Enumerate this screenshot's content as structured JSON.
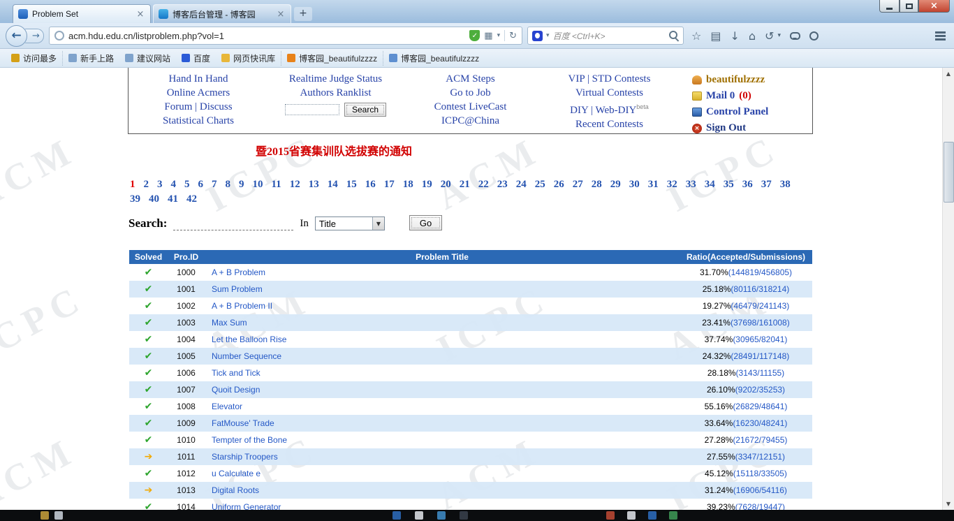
{
  "icons": {
    "close": "×",
    "new_tab": "+",
    "back": "←",
    "forward": "→",
    "reload": "↻",
    "caret": "▾",
    "select_caret": "▼",
    "check": "✓",
    "grid": "▦",
    "star": "☆",
    "list": "▤",
    "download": "↓",
    "home": "⌂",
    "history": "↺",
    "scroll_up": "▲",
    "scroll_down": "▼"
  },
  "browser": {
    "tabs": [
      {
        "title": "Problem Set"
      },
      {
        "title": "博客后台管理 - 博客园"
      }
    ],
    "url": "acm.hdu.edu.cn/listproblem.php?vol=1",
    "search_placeholder": "百度 <Ctrl+K>",
    "bookmarks": [
      "访问最多",
      "新手上路",
      "建议网站",
      "百度",
      "网页快讯库",
      "博客园_beautifulzzzz",
      "博客园_beautifulzzzz"
    ]
  },
  "site_nav": {
    "col1": [
      "Hand In Hand",
      "Online Acmers",
      "Forum | Discuss",
      "Statistical Charts"
    ],
    "col2": [
      "Realtime Judge Status",
      "Authors Ranklist"
    ],
    "search_input_value": "",
    "search_button": "Search",
    "col3": [
      "ACM Steps",
      "Go to Job",
      "Contest LiveCast",
      "ICPC@China"
    ],
    "col4": [
      "VIP | STD Contests",
      "Virtual Contests",
      "DIY | Web-DIY",
      "Recent Contests"
    ],
    "beta": "beta",
    "user": {
      "name": "beautifulzzzz",
      "mail": "Mail 0",
      "mail_badge": "(0)",
      "control_panel": "Control Panel",
      "sign_out": "Sign Out"
    }
  },
  "notice": "暨2015省赛集训队选拔赛的通知",
  "pagination": {
    "current": "1",
    "row1": [
      "1",
      "2",
      "3",
      "4",
      "5",
      "6",
      "7",
      "8",
      "9",
      "10",
      "11",
      "12",
      "13",
      "14",
      "15",
      "16",
      "17",
      "18",
      "19",
      "20",
      "21",
      "22",
      "23",
      "24",
      "25",
      "26",
      "27",
      "28",
      "29",
      "30",
      "31",
      "32",
      "33",
      "34",
      "35",
      "36",
      "37",
      "38"
    ],
    "row2": [
      "39",
      "40",
      "41",
      "42"
    ]
  },
  "search": {
    "label": "Search:",
    "input_value": "",
    "in_label": "In",
    "select_value": "Title",
    "go_button": "Go"
  },
  "problem_table": {
    "headers": [
      "Solved",
      "Pro.ID",
      "Problem Title",
      "Ratio(Accepted/Submissions)"
    ],
    "rows": [
      {
        "status": "solved",
        "icon": "✔",
        "id": "1000",
        "title": "A + B Problem",
        "percent": "31.70%",
        "ratio": "(144819/456805)"
      },
      {
        "status": "solved",
        "icon": "✔",
        "id": "1001",
        "title": "Sum Problem",
        "percent": "25.18%",
        "ratio": "(80116/318214)"
      },
      {
        "status": "solved",
        "icon": "✔",
        "id": "1002",
        "title": "A + B Problem II",
        "percent": "19.27%",
        "ratio": "(46479/241143)"
      },
      {
        "status": "solved",
        "icon": "✔",
        "id": "1003",
        "title": "Max Sum",
        "percent": "23.41%",
        "ratio": "(37698/161008)"
      },
      {
        "status": "solved",
        "icon": "✔",
        "id": "1004",
        "title": "Let the Balloon Rise",
        "percent": "37.74%",
        "ratio": "(30965/82041)"
      },
      {
        "status": "solved",
        "icon": "✔",
        "id": "1005",
        "title": "Number Sequence",
        "percent": "24.32%",
        "ratio": "(28491/117148)"
      },
      {
        "status": "solved",
        "icon": "✔",
        "id": "1006",
        "title": "Tick and Tick",
        "percent": "28.18%",
        "ratio": "(3143/11155)"
      },
      {
        "status": "solved",
        "icon": "✔",
        "id": "1007",
        "title": "Quoit Design",
        "percent": "26.10%",
        "ratio": "(9202/35253)"
      },
      {
        "status": "solved",
        "icon": "✔",
        "id": "1008",
        "title": "Elevator",
        "percent": "55.16%",
        "ratio": "(26829/48641)"
      },
      {
        "status": "solved",
        "icon": "✔",
        "id": "1009",
        "title": "FatMouse' Trade",
        "percent": "33.64%",
        "ratio": "(16230/48241)"
      },
      {
        "status": "solved",
        "icon": "✔",
        "id": "1010",
        "title": "Tempter of the Bone",
        "percent": "27.28%",
        "ratio": "(21672/79455)"
      },
      {
        "status": "tried",
        "icon": "➔",
        "id": "1011",
        "title": "Starship Troopers",
        "percent": "27.55%",
        "ratio": "(3347/12151)"
      },
      {
        "status": "solved",
        "icon": "✔",
        "id": "1012",
        "title": "u Calculate e",
        "percent": "45.12%",
        "ratio": "(15118/33505)"
      },
      {
        "status": "tried",
        "icon": "➔",
        "id": "1013",
        "title": "Digital Roots",
        "percent": "31.24%",
        "ratio": "(16906/54116)"
      },
      {
        "status": "solved",
        "icon": "✔",
        "id": "1014",
        "title": "Uniform Generator",
        "percent": "39.23%",
        "ratio": "(7628/19447)"
      }
    ]
  },
  "watermark": [
    "ACM",
    "ICPC"
  ],
  "colors": {
    "table_header_blue": "#2B69B5",
    "row_alt_blue": "#D6E7F7",
    "link_blue": "#2458C6",
    "solved_green": "#2EA52E",
    "tried_yellow": "#F2A900",
    "current_page_red": "#E00000",
    "notice_red": "#D10000"
  }
}
